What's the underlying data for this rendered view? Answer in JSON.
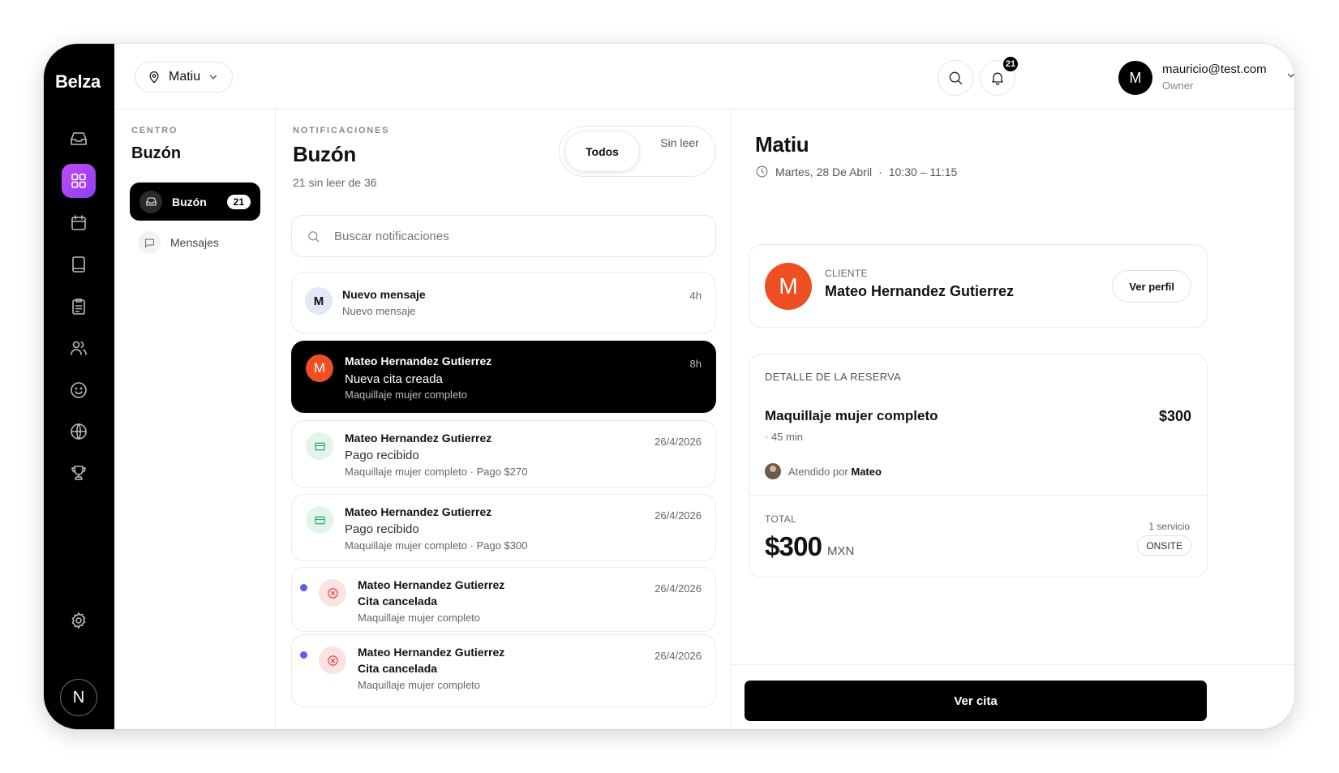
{
  "brand": "Belza",
  "rail": {
    "items": [
      {
        "icon": "inbox-icon",
        "active": false
      },
      {
        "icon": "grid-icon",
        "active": true
      },
      {
        "icon": "calendar-icon",
        "active": false
      },
      {
        "icon": "book-icon",
        "active": false
      },
      {
        "icon": "clipboard-icon",
        "active": false
      },
      {
        "icon": "users-icon",
        "active": false
      },
      {
        "icon": "smile-icon",
        "active": false
      },
      {
        "icon": "globe-icon",
        "active": false
      },
      {
        "icon": "trophy-icon",
        "active": false
      }
    ],
    "settings_icon": "gear-icon",
    "avatar_initial": "N"
  },
  "topbar": {
    "location": "Matiu",
    "notification_count": "21",
    "user_initial": "M",
    "user_email": "mauricio@test.com",
    "user_role": "Owner"
  },
  "panel1": {
    "eyebrow": "CENTRO",
    "title": "Buzón",
    "active_item": {
      "label": "Buzón",
      "count": "21"
    },
    "item": {
      "label": "Mensajes"
    }
  },
  "panel2": {
    "eyebrow": "NOTIFICACIONES",
    "title": "Buzón",
    "subtitle": "21 sin leer de 36",
    "filter_all": "Todos",
    "filter_unread": "Sin leer",
    "search_placeholder": "Buscar notificaciones",
    "notifications": [
      {
        "initial": "M",
        "title": "Nuevo mensaje",
        "line": "Nuevo mensaje",
        "meta": "",
        "time": "4h"
      },
      {
        "initial": "M",
        "title": "Mateo Hernandez Gutierrez",
        "line": "Nueva cita creada",
        "meta": "Maquillaje mujer completo",
        "time": "8h"
      },
      {
        "title": "Mateo Hernandez Gutierrez",
        "line": "Pago recibido",
        "meta": "Maquillaje mujer completo · Pago $270",
        "time": "26/4/2026"
      },
      {
        "title": "Mateo Hernandez Gutierrez",
        "line": "Pago recibido",
        "meta": "Maquillaje mujer completo · Pago $300",
        "time": "26/4/2026"
      },
      {
        "title": "Mateo Hernandez Gutierrez",
        "line": "Cita cancelada",
        "meta": "Maquillaje mujer completo",
        "time": "26/4/2026"
      },
      {
        "title": "Mateo Hernandez Gutierrez",
        "line": "Cita cancelada",
        "meta": "Maquillaje mujer completo",
        "time": "26/4/2026"
      }
    ]
  },
  "detail": {
    "title": "Matiu",
    "date": "Martes, 28 De Abril",
    "separator": "·",
    "time_range": "10:30 – 11:15",
    "client": {
      "initial": "M",
      "eyebrow": "CLIENTE",
      "name": "Mateo Hernandez Gutierrez",
      "profile_button": "Ver perfil"
    },
    "booking": {
      "eyebrow": "DETALLE DE LA RESERVA",
      "service": "Maquillaje mujer completo",
      "price": "$300",
      "duration": "· 45 min",
      "attended_prefix": "Atendido por",
      "staff": "Mateo",
      "total_eyebrow": "TOTAL",
      "total": "$300",
      "currency": "MXN",
      "service_count": "1 servicio",
      "mode": "ONSITE"
    },
    "cta": "Ver cita"
  },
  "colors": {
    "accent_gradient_start": "#c34bf0",
    "accent_gradient_end": "#8a3ff5",
    "avatar_orange": "#ee4f22",
    "unread_dot": "#5a5ff0"
  }
}
